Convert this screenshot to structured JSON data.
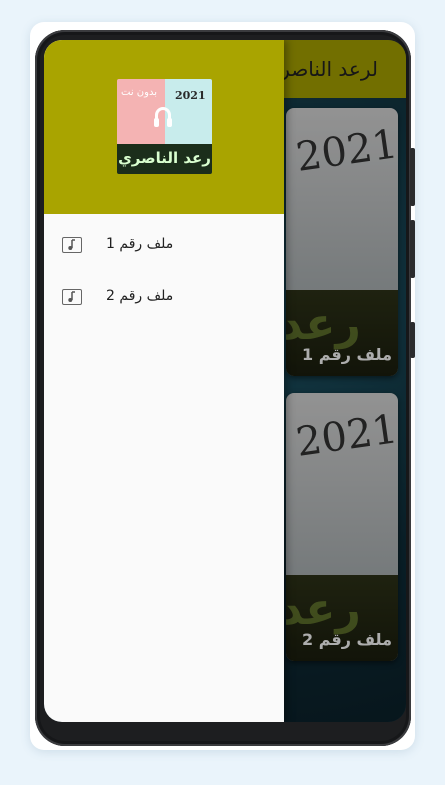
{
  "app": {
    "title": "لرعد الناصري"
  },
  "drawer": {
    "logo": {
      "subtitle": "بدون نت",
      "year": "2021",
      "name": "رعد الناصري"
    },
    "items": [
      {
        "label": "ملف رقم 1",
        "icon": "music-note-icon"
      },
      {
        "label": "ملف رقم 2",
        "icon": "music-note-icon"
      }
    ]
  },
  "list": {
    "cards": [
      {
        "year": "2021",
        "caption": "ملف رقم 1",
        "overlay": "رعد"
      },
      {
        "year": "2021",
        "caption": "ملف رقم 2",
        "overlay": "رعد"
      }
    ]
  },
  "colors": {
    "accent": "#a9a400",
    "drawer_bg": "#fafafa",
    "list_bg": "#14323f"
  }
}
